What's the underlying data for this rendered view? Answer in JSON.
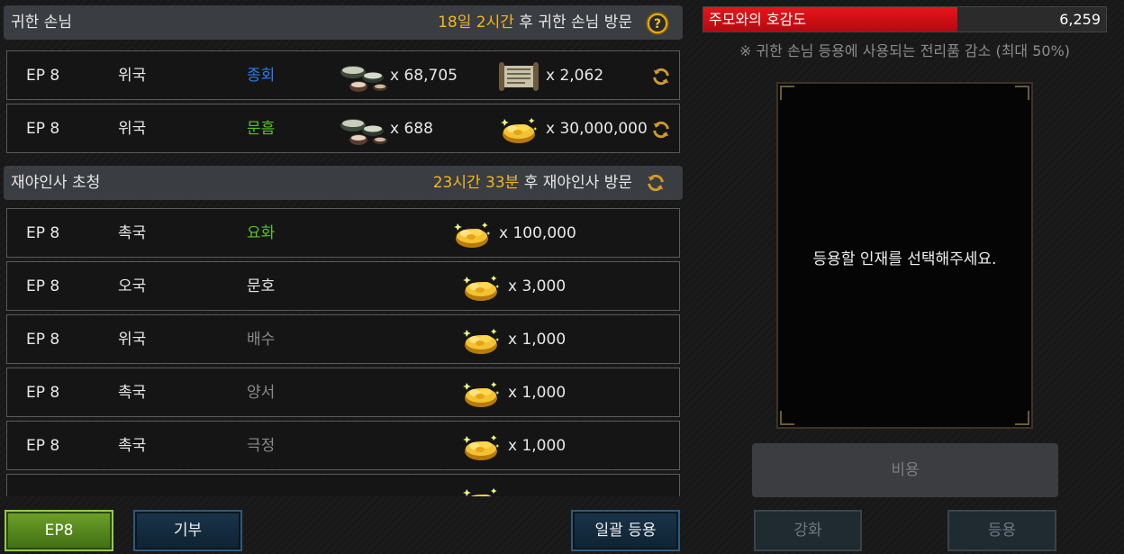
{
  "noble_guest": {
    "title": "귀한 손님",
    "timer": "18일 2시간",
    "suffix": " 후 귀한 손님 방문",
    "help_icon": "question-icon",
    "rows": [
      {
        "ep": "EP 8",
        "country": "위국",
        "name": "종회",
        "name_color": "#2d7bf0",
        "item1_icon": "tea-set-icon",
        "item1_qty": "x 68,705",
        "item2_icon": "scroll-icon",
        "item2_qty": "x 2,062"
      },
      {
        "ep": "EP 8",
        "country": "위국",
        "name": "문흠",
        "name_color": "#5cc225",
        "item1_icon": "tea-set-icon",
        "item1_qty": "x 688",
        "item2_icon": "gold-ingot-icon",
        "item2_qty": "x 30,000,000"
      }
    ]
  },
  "recruit": {
    "title": "재야인사 초청",
    "timer": "23시간 33분",
    "suffix": " 후 재야인사 방문",
    "refresh_icon": "refresh-icon",
    "rows": [
      {
        "ep": "EP 8",
        "country": "촉국",
        "name": "요화",
        "name_color": "#5cc225",
        "icon": "gold-ingot-icon",
        "qty": "x 100,000"
      },
      {
        "ep": "EP 8",
        "country": "오국",
        "name": "문호",
        "name_color": "#e8e8e8",
        "icon": "gold-ingot-icon",
        "qty": "x 3,000"
      },
      {
        "ep": "EP 8",
        "country": "위국",
        "name": "배수",
        "name_color": "#8a8a8a",
        "icon": "gold-ingot-icon",
        "qty": "x 1,000"
      },
      {
        "ep": "EP 8",
        "country": "촉국",
        "name": "양서",
        "name_color": "#8a8a8a",
        "icon": "gold-ingot-icon",
        "qty": "x 1,000"
      },
      {
        "ep": "EP 8",
        "country": "촉국",
        "name": "극정",
        "name_color": "#8a8a8a",
        "icon": "gold-ingot-icon",
        "qty": "x 1,000"
      }
    ]
  },
  "bottom_buttons": {
    "ep": "EP8",
    "donate": "기부",
    "bulk_recruit": "일괄 등용"
  },
  "favor": {
    "label": "주모와의 호감도",
    "value": "6,259",
    "fill_fraction": 0.63,
    "fill_color": "#e8141b",
    "note": "※ 귀한 손님 등용에 사용되는 전리품 감소 (최대 50%)"
  },
  "selection": {
    "message": "등용할 인재를 선택해주세요.",
    "cost_label": "비용",
    "enhance_label": "강화",
    "recruit_label": "등용"
  }
}
